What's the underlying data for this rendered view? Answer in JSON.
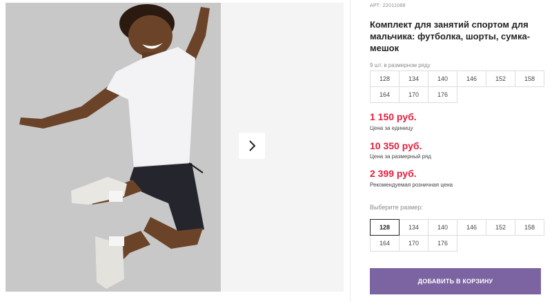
{
  "product": {
    "sku": "АРТ: 22011088",
    "title": "Комплект для занятий спортом для мальчика: футболка, шорты, сумка-мешок",
    "row_note": "9 шт. в размерном ряду",
    "row_sizes": [
      "128",
      "134",
      "140",
      "146",
      "152",
      "158",
      "164",
      "170",
      "176"
    ]
  },
  "prices": [
    {
      "value": "1 150 руб.",
      "label": "Цена за единицу"
    },
    {
      "value": "10 350 руб.",
      "label": "Цена за размерный ряд"
    },
    {
      "value": "2 399 руб.",
      "label": "Рекомендуемая розничная цена"
    }
  ],
  "size_picker": {
    "label": "Выберите размер:",
    "options": [
      "128",
      "134",
      "140",
      "146",
      "152",
      "158",
      "164",
      "170",
      "176"
    ],
    "selected": "128"
  },
  "cart_button": "ДОБАВИТЬ В КОРЗИНУ",
  "colors": {
    "price": "#e31e3c",
    "button": "#7b64a1"
  }
}
